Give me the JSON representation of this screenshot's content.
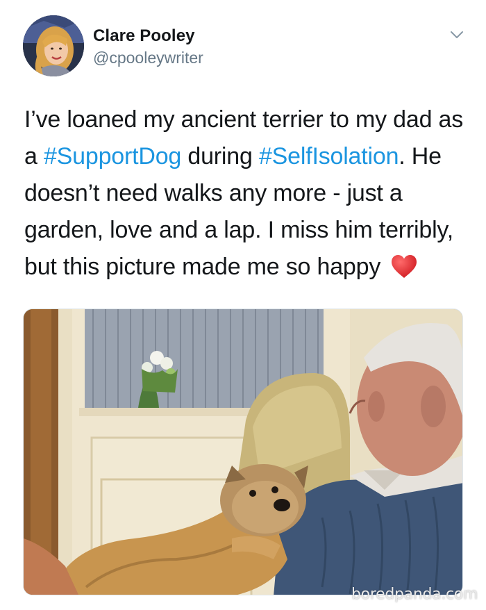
{
  "author": {
    "display_name": "Clare Pooley",
    "handle": "@cpooleywriter",
    "avatar_icon": "profile-photo"
  },
  "menu_icon": "chevron-down-icon",
  "tweet": {
    "segments": [
      {
        "text": "I’ve loaned my ancient terrier to my dad as a ",
        "type": "text"
      },
      {
        "text": "#SupportDog",
        "type": "hashtag"
      },
      {
        "text": " during ",
        "type": "text"
      },
      {
        "text": "#SelfIsolation",
        "type": "hashtag"
      },
      {
        "text": ". He doesn’t need walks any more - just a garden, love and a lap. I miss him terribly, but this picture made me so happy ",
        "type": "text"
      }
    ],
    "emoji_icon": "red-heart-icon"
  },
  "colors": {
    "text": "#14171a",
    "secondary_text": "#657786",
    "hashtag": "#1b95e0",
    "heart": "#e0242a"
  },
  "watermark": "boredpanda.com"
}
